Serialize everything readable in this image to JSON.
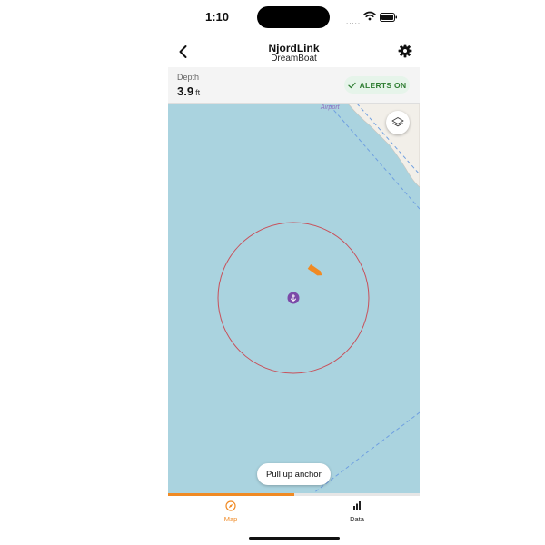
{
  "status_bar": {
    "time": "1:10",
    "signal": "....."
  },
  "nav": {
    "title": "NjordLink",
    "subtitle": "DreamBoat"
  },
  "depth": {
    "label": "Depth",
    "value": "3.9",
    "unit": "ft"
  },
  "alerts": {
    "label": "ALERTS ON"
  },
  "map": {
    "place_label": "Airport",
    "colors": {
      "water": "#aad3df",
      "land": "#f2efe9",
      "boat": "#f08a24",
      "anchor": "#7b4aa8",
      "radius_circle": "#c8505a"
    }
  },
  "actions": {
    "pull_anchor_label": "Pull up anchor"
  },
  "tabs": [
    {
      "label": "Map",
      "active": true
    },
    {
      "label": "Data",
      "active": false
    }
  ],
  "tab_progress": 0.5,
  "colors": {
    "accent": "#f08a24",
    "success": "#2e7d32"
  }
}
